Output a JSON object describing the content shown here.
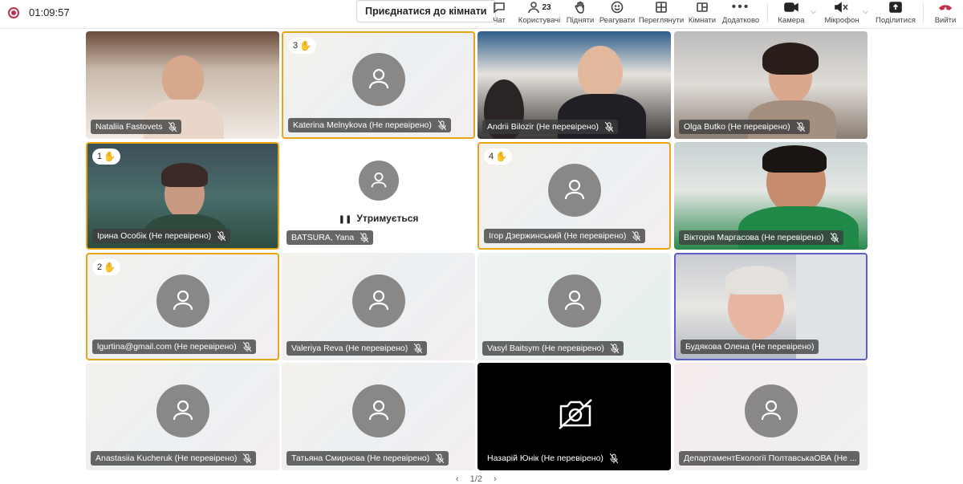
{
  "header": {
    "timer": "01:09:57",
    "join_button": "Приєднатися до кімнати",
    "buttons": {
      "chat": "Чат",
      "people": "Користувачі",
      "people_count": "23",
      "raise": "Підняти",
      "react": "Реагувати",
      "view": "Переглянути",
      "rooms": "Кімнати",
      "more": "Додатково",
      "camera": "Камера",
      "mic": "Мікрофон",
      "share": "Поділитися",
      "leave": "Вийти"
    },
    "colors": {
      "leave": "#c4314b",
      "recording": "#c4314b",
      "raised_hand_border": "#e8a317",
      "speaking_border": "#5b5fc7"
    }
  },
  "tiles": [
    {
      "name": "Nataliia Fastovets",
      "video": true
    },
    {
      "name": "Katerina Melnykova (Не перевірено)",
      "hand": "3"
    },
    {
      "name": "Andrii Bilozir (Не перевірено)",
      "video": true
    },
    {
      "name": "Olga Butko (Не перевірено)",
      "video": true
    },
    {
      "name": "Ірина Особік (Не перевірено)",
      "hand": "1",
      "video": true
    },
    {
      "name": "BATSURA, Yana",
      "status": "Утримується"
    },
    {
      "name": "Ігор Дзержинський (Не перевірено)",
      "hand": "4"
    },
    {
      "name": "Вікторія Маргасова (Не перевірено)",
      "video": true
    },
    {
      "name": "lgurtina@gmail.com (Не перевірено)",
      "hand": "2"
    },
    {
      "name": "Valeriya Reva (Не перевірено)"
    },
    {
      "name": "Vasyl Baitsym (Не перевірено)"
    },
    {
      "name": "Будякова Олена (Не перевірено)",
      "video": true,
      "speaking": true
    },
    {
      "name": "Anastasiia Kucheruk (Не перевірено)"
    },
    {
      "name": "Татьяна Смирнова (Не перевірено)"
    },
    {
      "name": "Назарій Юнік (Не перевірено)",
      "camera_off": true
    },
    {
      "name": "ДепартаментЕкології ПолтавськаОВА (Не ..."
    }
  ],
  "pager": {
    "label": "1/2"
  }
}
